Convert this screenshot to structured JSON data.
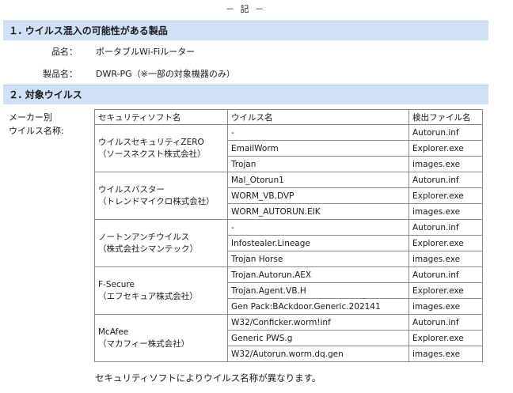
{
  "heading": "－ 記 －",
  "section1": {
    "title": "１. ウイルス混入の可能性がある製品",
    "product_label": "品名：",
    "product_value": "ポータブルWi-Fiルーター",
    "model_label": "製品名：",
    "model_value": "DWR-PG（※一部の対象機器のみ）"
  },
  "section2": {
    "title": "２. 対象ウイルス",
    "side_label_1": "メーカー別",
    "side_label_2": "ウイルス名称:",
    "table": {
      "headers": [
        "セキュリティソフト名",
        "ウイルス名",
        "検出ファイル名"
      ],
      "groups": [
        {
          "vendor_1": "ウイルスセキュリティZERO",
          "vendor_2": "（ソースネクスト株式会社）",
          "rows": [
            [
              "-",
              "Autorun.inf"
            ],
            [
              "EmailWorm",
              "Explorer.exe"
            ],
            [
              "Trojan",
              "images.exe"
            ]
          ]
        },
        {
          "vendor_1": "ウイルスバスター",
          "vendor_2": "（トレンドマイクロ株式会社）",
          "rows": [
            [
              "Mal_Otorun1",
              "Autorun.inf"
            ],
            [
              "WORM_VB.DVP",
              "Explorer.exe"
            ],
            [
              "WORM_AUTORUN.EIK",
              "images.exe"
            ]
          ]
        },
        {
          "vendor_1": "ノートンアンチウイルス",
          "vendor_2": "（株式会社シマンテック）",
          "rows": [
            [
              "-",
              "Autorun.inf"
            ],
            [
              "Infostealer.Lineage",
              "Explorer.exe"
            ],
            [
              "Trojan Horse",
              "images.exe"
            ]
          ]
        },
        {
          "vendor_1": "F-Secure",
          "vendor_2": "（エフセキュア株式会社）",
          "rows": [
            [
              "Trojan.Autorun.AEX",
              "Autorun.inf"
            ],
            [
              "Trojan.Agent.VB.H",
              "Explorer.exe"
            ],
            [
              "Gen Pack:BAckdoor.Generic.202141",
              "images.exe"
            ]
          ]
        },
        {
          "vendor_1": "McAfee",
          "vendor_2": "（マカフィー株式会社）",
          "rows": [
            [
              "W32/Conficker.worm!inf",
              "Autorun.inf"
            ],
            [
              "Generic PWS.g",
              "Explorer.exe"
            ],
            [
              "W32/Autorun.worm.dq.gen",
              "images.exe"
            ]
          ]
        }
      ]
    },
    "footnote": "セキュリティソフトによりウイルス名称が異なります。"
  }
}
